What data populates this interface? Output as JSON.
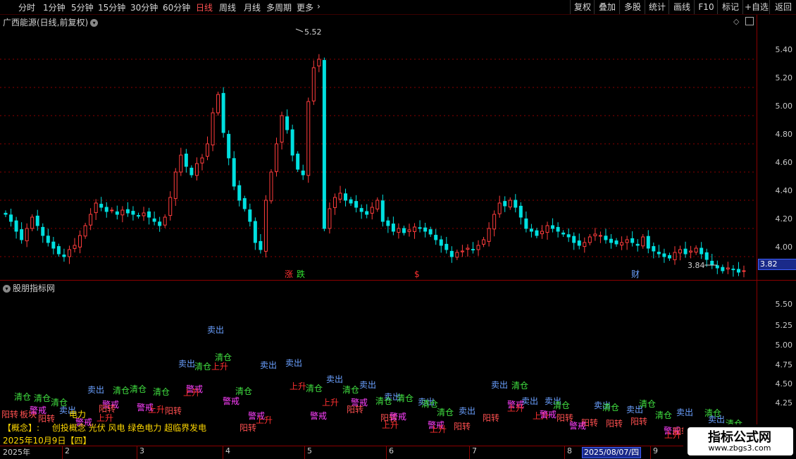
{
  "toolbar": {
    "periods": [
      "分时",
      "1分钟",
      "5分钟",
      "15分钟",
      "30分钟",
      "60分钟",
      "日线",
      "周线",
      "月线",
      "多周期",
      "更多"
    ],
    "active_period": "日线",
    "more_arrow": "›",
    "right_buttons": [
      "复权",
      "叠加",
      "多股",
      "统计",
      "画线",
      "F10",
      "标记",
      "+自选",
      "返回"
    ]
  },
  "main_panel": {
    "title": "广西能源(日线,前复权)",
    "y_labels": [
      "5.40",
      "5.20",
      "5.00",
      "4.80",
      "4.60",
      "4.40",
      "4.20",
      "4.00"
    ],
    "current_price": "3.82",
    "high_label": "5.52",
    "low_label": "3.84",
    "markers": [
      {
        "text": "涨",
        "color": "#ff3030"
      },
      {
        "text": "跌",
        "color": "#30e030"
      },
      {
        "text": "$",
        "color": "#ff3030"
      },
      {
        "text": "财",
        "color": "#6aa0ff"
      }
    ]
  },
  "indicator_panel": {
    "title": "股朋指标网",
    "y_labels": [
      "5.50",
      "5.25",
      "5.00",
      "4.75",
      "4.50",
      "4.25"
    ]
  },
  "concept": {
    "label": "【概念】:",
    "text": "创投概念 光伏 风电 绿色电力 超临界发电"
  },
  "date_info": "2025年10月9日【四】",
  "bottom_axis": {
    "labels": [
      "2025年",
      "2",
      "3",
      "4",
      "5",
      "6",
      "7",
      "8",
      "9"
    ],
    "cursor_date": "2025/08/07/四"
  },
  "watermark": {
    "title": "指标公式网",
    "url": "www.zbgs3.com"
  },
  "colors": {
    "up": "#ff3c3c",
    "down": "#00e0e0",
    "grid": "#8b0000",
    "signal_sell": "#6aa0ff",
    "signal_clear": "#40e040",
    "signal_warn": "#ff40ff",
    "signal_yang": "#ff5050",
    "signal_rise": "#ff3030"
  },
  "chart_data": {
    "type": "candlestick",
    "price_high": 5.52,
    "price_low": 3.84,
    "last_price": 3.82,
    "y_ticks": [
      4.0,
      4.2,
      4.4,
      4.6,
      4.8,
      5.0,
      5.2,
      5.4
    ],
    "closes": [
      4.3,
      4.25,
      4.18,
      4.12,
      4.2,
      4.28,
      4.22,
      4.15,
      4.1,
      4.06,
      4.02,
      4.0,
      4.05,
      4.08,
      4.15,
      4.22,
      4.3,
      4.38,
      4.35,
      4.32,
      4.33,
      4.3,
      4.33,
      4.31,
      4.3,
      4.29,
      4.31,
      4.28,
      4.25,
      4.22,
      4.28,
      4.42,
      4.6,
      4.72,
      4.64,
      4.58,
      4.66,
      4.7,
      4.8,
      5.02,
      5.15,
      4.88,
      4.7,
      4.5,
      4.4,
      4.34,
      4.25,
      4.1,
      4.05,
      4.4,
      4.6,
      4.8,
      5.0,
      4.9,
      4.72,
      4.62,
      4.58,
      5.1,
      5.34,
      5.4,
      4.2,
      4.34,
      4.42,
      4.45,
      4.4,
      4.38,
      4.35,
      4.32,
      4.3,
      4.35,
      4.4,
      4.25,
      4.22,
      4.18,
      4.2,
      4.17,
      4.19,
      4.21,
      4.2,
      4.18,
      4.16,
      4.12,
      4.08,
      4.05,
      4.0,
      4.03,
      4.04,
      4.06,
      4.05,
      4.08,
      4.12,
      4.2,
      4.3,
      4.38,
      4.36,
      4.4,
      4.35,
      4.28,
      4.2,
      4.18,
      4.15,
      4.18,
      4.22,
      4.2,
      4.18,
      4.16,
      4.14,
      4.1,
      4.08,
      4.1,
      4.14,
      4.16,
      4.15,
      4.12,
      4.1,
      4.09,
      4.1,
      4.12,
      4.1,
      4.08,
      4.14,
      4.06,
      4.04,
      4.02,
      4.0,
      3.99,
      4.03,
      4.05,
      4.02,
      4.04,
      4.06,
      4.02,
      3.98,
      3.94,
      3.92,
      3.9,
      3.92,
      3.91,
      3.89,
      3.9
    ]
  }
}
